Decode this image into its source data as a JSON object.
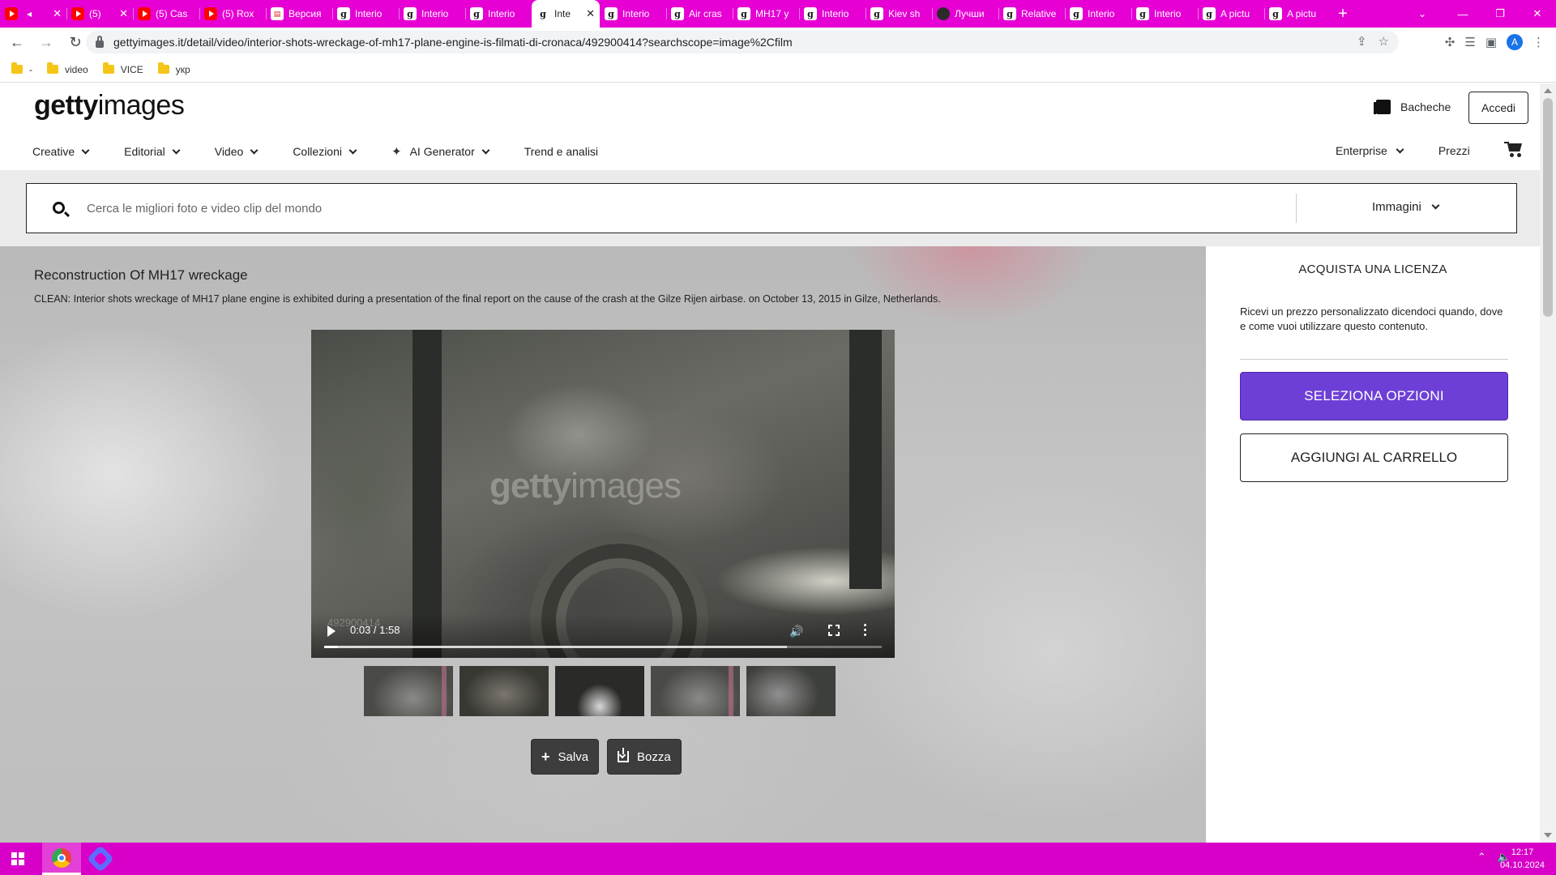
{
  "browser": {
    "tabs": [
      {
        "icon": "youtube-icon",
        "title": "",
        "active": false,
        "audio": true
      },
      {
        "icon": "youtube-icon",
        "title": "(5)",
        "active": false
      },
      {
        "icon": "youtube-icon",
        "title": "(5) Cas",
        "active": false
      },
      {
        "icon": "youtube-icon",
        "title": "(5) Rox",
        "active": false
      },
      {
        "icon": "document-icon",
        "title": "Версия",
        "active": false
      },
      {
        "icon": "getty-icon",
        "title": "Interio",
        "active": false
      },
      {
        "icon": "getty-icon",
        "title": "Interio",
        "active": false
      },
      {
        "icon": "getty-icon",
        "title": "Interio",
        "active": false
      },
      {
        "icon": "getty-icon",
        "title": "Inte",
        "active": true
      },
      {
        "icon": "getty-icon",
        "title": "Interio",
        "active": false
      },
      {
        "icon": "getty-icon",
        "title": "Air cras",
        "active": false
      },
      {
        "icon": "getty-icon",
        "title": "MH17 y",
        "active": false
      },
      {
        "icon": "getty-icon",
        "title": "Interio",
        "active": false
      },
      {
        "icon": "getty-icon",
        "title": "Kiev sh",
        "active": false
      },
      {
        "icon": "cube-icon",
        "title": "Лучши",
        "active": false
      },
      {
        "icon": "getty-icon",
        "title": "Relative",
        "active": false
      },
      {
        "icon": "getty-icon",
        "title": "Interio",
        "active": false
      },
      {
        "icon": "getty-icon",
        "title": "Interio",
        "active": false
      },
      {
        "icon": "getty-icon",
        "title": "A pictu",
        "active": false
      },
      {
        "icon": "getty-icon",
        "title": "A pictu",
        "active": false
      }
    ],
    "url": "gettyimages.it/detail/video/interior-shots-wreckage-of-mh17-plane-engine-is-filmati-di-cronaca/492900414?searchscope=image%2Cfilm",
    "profile_initial": "A",
    "bookmarks": [
      "-",
      "video",
      "VICE",
      "укр"
    ]
  },
  "header": {
    "logo_bold": "getty",
    "logo_light": "images",
    "boards_label": "Bacheche",
    "login_label": "Accedi",
    "nav": {
      "creative": "Creative",
      "editorial": "Editorial",
      "video": "Video",
      "collections": "Collezioni",
      "ai_generator": "AI Generator",
      "trends": "Trend e analisi"
    },
    "enterprise": "Enterprise",
    "pricing": "Prezzi"
  },
  "search": {
    "placeholder": "Cerca le migliori foto e video clip del mondo",
    "scope": "Immagini"
  },
  "asset": {
    "title": "Reconstruction Of MH17 wreckage",
    "caption": "CLEAN: Interior shots wreckage of MH17 plane engine is exhibited during a presentation of the final report on the cause of the crash at the Gilze Rijen airbase. on October 13, 2015 in Gilze, Netherlands.",
    "watermark_bold": "getty",
    "watermark_light": "images",
    "watermark_id": "492900414",
    "player": {
      "time": "0:03 / 1:58",
      "progress_fraction": 0.025,
      "buffered_fraction": 0.83
    },
    "save_label": "Salva",
    "comp_label": "Bozza"
  },
  "license": {
    "title": "ACQUISTA UNA LICENZA",
    "text": "Ricevi un prezzo personalizzato dicendoci quando, dove e come vuoi utilizzare questo contenuto.",
    "select_options": "SELEZIONA OPZIONI",
    "add_to_cart": "AGGIUNGI AL CARRELLO",
    "accent_color": "#6d3fd6"
  },
  "taskbar": {
    "time": "12:17",
    "date": "04.10.2024",
    "color": "#d800c8"
  }
}
